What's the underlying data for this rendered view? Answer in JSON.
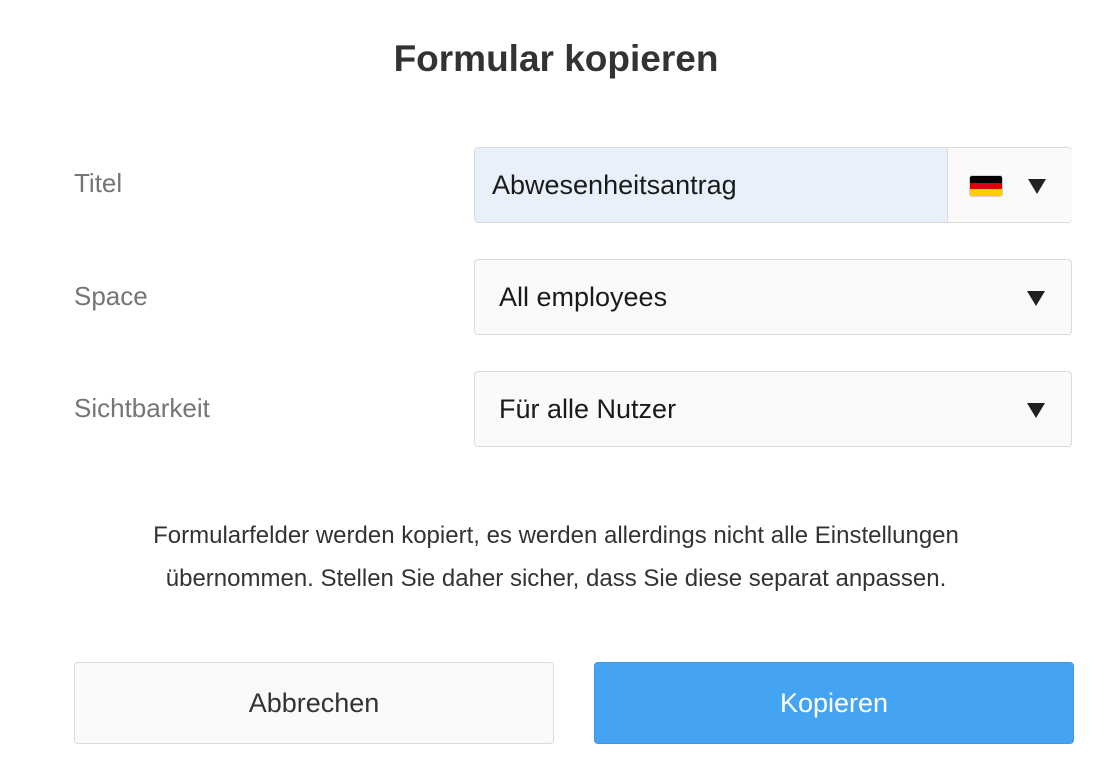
{
  "dialog": {
    "title": "Formular kopieren",
    "notice_line1": "Formularfelder werden kopiert, es werden allerdings nicht alle Einstellungen",
    "notice_line2": "übernommen. Stellen Sie daher sicher, dass Sie diese separat anpassen."
  },
  "fields": {
    "title": {
      "label": "Titel",
      "value": "Abwesenheitsantrag",
      "language_flag_icon": "german-flag-icon"
    },
    "space": {
      "label": "Space",
      "value": "All employees"
    },
    "visibility": {
      "label": "Sichtbarkeit",
      "value": "Für alle Nutzer"
    }
  },
  "buttons": {
    "cancel_label": "Abbrechen",
    "copy_label": "Kopieren"
  },
  "colors": {
    "primary": "#44a4f2",
    "input_highlight": "#e8f0fc",
    "flag_black": "#000000",
    "flag_red": "#dd0000",
    "flag_gold": "#ffce00"
  }
}
